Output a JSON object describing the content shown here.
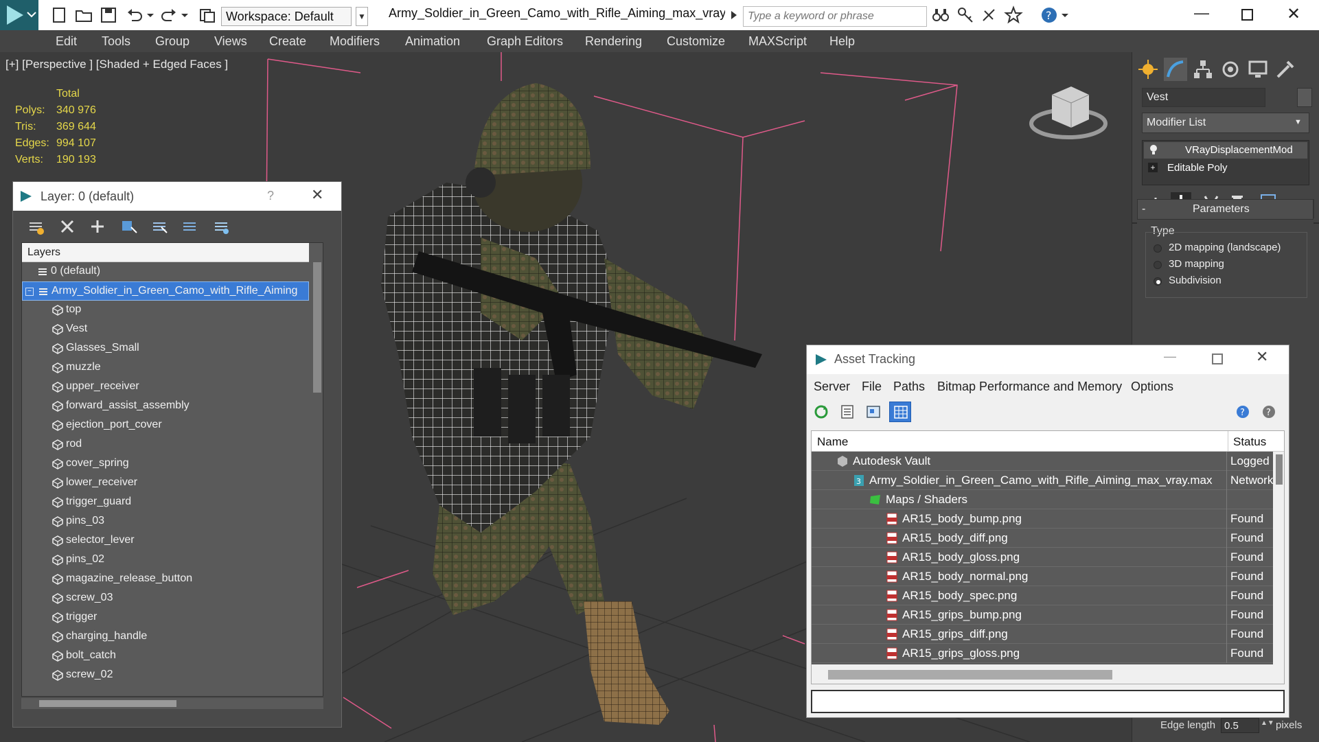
{
  "titlebar": {
    "workspace": "Workspace: Default",
    "document_title": "Army_Soldier_in_Green_Camo_with_Rifle_Aiming_max_vray....",
    "search_placeholder": "Type a keyword or phrase"
  },
  "menu": [
    "Edit",
    "Tools",
    "Group",
    "Views",
    "Create",
    "Modifiers",
    "Animation",
    "Graph Editors",
    "Rendering",
    "Customize",
    "MAXScript",
    "Help"
  ],
  "viewport": {
    "label": "[+] [Perspective ] [Shaded + Edged Faces ]",
    "stats_header": "Total",
    "stats": [
      {
        "label": "Polys:",
        "value": "340 976"
      },
      {
        "label": "Tris:",
        "value": "369 644"
      },
      {
        "label": "Edges:",
        "value": "994 107"
      },
      {
        "label": "Verts:",
        "value": "190 193"
      }
    ]
  },
  "layer_dialog": {
    "title": "Layer: 0 (default)",
    "help": "?",
    "column_header": "Layers",
    "root_layers": [
      {
        "label": "0 (default)",
        "selected": false
      },
      {
        "label": "Army_Soldier_in_Green_Camo_with_Rifle_Aiming",
        "selected": true
      }
    ],
    "objects": [
      "top",
      "Vest",
      "Glasses_Small",
      "muzzle",
      "upper_receiver",
      "forward_assist_assembly",
      "ejection_port_cover",
      "rod",
      "cover_spring",
      "lower_receiver",
      "trigger_guard",
      "pins_03",
      "selector_lever",
      "pins_02",
      "magazine_release_button",
      "screw_03",
      "trigger",
      "charging_handle",
      "bolt_catch",
      "screw_02"
    ]
  },
  "command_panel": {
    "object_name": "Vest",
    "modifier_list": "Modifier List",
    "modifier_stack": [
      "VRayDisplacementMod",
      "Editable Poly"
    ],
    "rollout_title": "Parameters",
    "rollout_collapse": "-",
    "type_label": "Type",
    "type_options": [
      {
        "label": "2D mapping (landscape)",
        "checked": false
      },
      {
        "label": "3D mapping",
        "checked": false
      },
      {
        "label": "Subdivision",
        "checked": true
      }
    ],
    "edge_length_label": "Edge length",
    "edge_length_value": "0.5",
    "edge_length_unit": "pixels"
  },
  "asset_tracking": {
    "title": "Asset Tracking",
    "menu": [
      "Server",
      "File",
      "Paths",
      "Bitmap Performance and Memory",
      "Options"
    ],
    "columns": {
      "name": "Name",
      "status": "Status"
    },
    "rows": [
      {
        "name": "Autodesk Vault",
        "status": "Logged",
        "indent": 0,
        "icon": "vault-icon"
      },
      {
        "name": "Army_Soldier_in_Green_Camo_with_Rifle_Aiming_max_vray.max",
        "status": "Network",
        "indent": 1,
        "icon": "max-file-icon"
      },
      {
        "name": "Maps / Shaders",
        "status": "",
        "indent": 2,
        "icon": "maps-folder-icon"
      },
      {
        "name": "AR15_body_bump.png",
        "status": "Found",
        "indent": 3,
        "icon": "png-file-icon"
      },
      {
        "name": "AR15_body_diff.png",
        "status": "Found",
        "indent": 3,
        "icon": "png-file-icon"
      },
      {
        "name": "AR15_body_gloss.png",
        "status": "Found",
        "indent": 3,
        "icon": "png-file-icon"
      },
      {
        "name": "AR15_body_normal.png",
        "status": "Found",
        "indent": 3,
        "icon": "png-file-icon"
      },
      {
        "name": "AR15_body_spec.png",
        "status": "Found",
        "indent": 3,
        "icon": "png-file-icon"
      },
      {
        "name": "AR15_grips_bump.png",
        "status": "Found",
        "indent": 3,
        "icon": "png-file-icon"
      },
      {
        "name": "AR15_grips_diff.png",
        "status": "Found",
        "indent": 3,
        "icon": "png-file-icon"
      },
      {
        "name": "AR15_grips_gloss.png",
        "status": "Found",
        "indent": 3,
        "icon": "png-file-icon"
      }
    ]
  },
  "colors": {
    "selection_blue": "#3a7bd5",
    "stats_yellow": "#e6d84a",
    "bounding_box_pink": "#e05a8a",
    "asset_row_bg": "#5a5a5a"
  }
}
